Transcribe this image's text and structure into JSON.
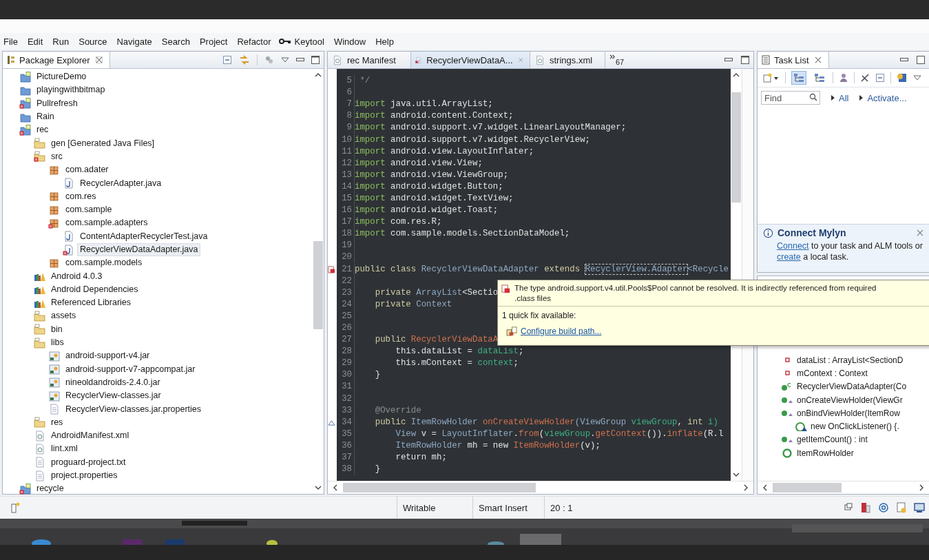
{
  "menu": [
    "File",
    "Edit",
    "Run",
    "Source",
    "Navigate",
    "Search",
    "Project",
    "Refactor",
    "Keytool",
    "Window",
    "Help"
  ],
  "package_explorer": {
    "title": "Package Explorer",
    "tree": [
      {
        "label": "PictureDemo",
        "kind": "android-project",
        "error": false,
        "selected": false
      },
      {
        "label": "playingwithbitmap",
        "kind": "project",
        "error": false,
        "selected": false
      },
      {
        "label": "Pullrefresh",
        "kind": "android-project",
        "error": true,
        "selected": false
      },
      {
        "label": "Rain",
        "kind": "project",
        "error": false,
        "selected": false
      },
      {
        "label": "rec",
        "kind": "android-project",
        "error": true,
        "selected": false,
        "children": [
          {
            "label": "gen [Generated Java Files]",
            "kind": "folder",
            "error": false,
            "selected": false
          },
          {
            "label": "src",
            "kind": "folder",
            "error": true,
            "selected": false,
            "children": [
              {
                "label": "com.adater",
                "kind": "package",
                "error": false,
                "selected": false,
                "children": [
                  {
                    "label": "RecyclerAdapter.java",
                    "kind": "java",
                    "error": false,
                    "selected": false
                  }
                ]
              },
              {
                "label": "com.res",
                "kind": "package",
                "error": false,
                "selected": false
              },
              {
                "label": "com.sample",
                "kind": "package",
                "error": false,
                "selected": false
              },
              {
                "label": "com.sample.adapters",
                "kind": "package",
                "error": true,
                "selected": false,
                "children": [
                  {
                    "label": "ContentAdapterRecyclerTest.java",
                    "kind": "java",
                    "error": false,
                    "selected": false
                  },
                  {
                    "label": "RecyclerViewDataAdapter.java",
                    "kind": "java",
                    "error": true,
                    "selected": true
                  }
                ]
              },
              {
                "label": "com.sample.models",
                "kind": "package",
                "error": false,
                "selected": false
              }
            ]
          },
          {
            "label": "Android 4.0.3",
            "kind": "library",
            "error": false,
            "selected": false
          },
          {
            "label": "Android Dependencies",
            "kind": "library",
            "error": false,
            "selected": false
          },
          {
            "label": "Referenced Libraries",
            "kind": "library",
            "error": false,
            "selected": false
          },
          {
            "label": "assets",
            "kind": "folder",
            "error": false,
            "selected": false
          },
          {
            "label": "bin",
            "kind": "folder",
            "error": false,
            "selected": false
          },
          {
            "label": "libs",
            "kind": "folder",
            "error": false,
            "selected": false,
            "children": [
              {
                "label": "android-support-v4.jar",
                "kind": "jar",
                "error": false,
                "selected": false
              },
              {
                "label": "android-support-v7-appcompat.jar",
                "kind": "jar",
                "error": false,
                "selected": false
              },
              {
                "label": "nineoldandroids-2.4.0.jar",
                "kind": "jar",
                "error": false,
                "selected": false
              },
              {
                "label": "RecyclerView-classes.jar",
                "kind": "jar",
                "error": false,
                "selected": false
              },
              {
                "label": "RecyclerView-classes.jar.properties",
                "kind": "file",
                "error": false,
                "selected": false
              }
            ]
          },
          {
            "label": "res",
            "kind": "folder",
            "error": false,
            "selected": false
          },
          {
            "label": "AndroidManifest.xml",
            "kind": "xml",
            "error": false,
            "selected": false
          },
          {
            "label": "lint.xml",
            "kind": "xml",
            "error": false,
            "selected": false
          },
          {
            "label": "proguard-project.txt",
            "kind": "file",
            "error": false,
            "selected": false
          },
          {
            "label": "project.properties",
            "kind": "file",
            "error": false,
            "selected": false
          }
        ]
      },
      {
        "label": "recycle",
        "kind": "android-project",
        "error": true,
        "selected": false
      }
    ]
  },
  "editor": {
    "tabs": [
      {
        "label": "rec Manifest",
        "kind": "xml",
        "selected": false
      },
      {
        "label": "RecyclerViewDataA...",
        "kind": "java",
        "selected": true
      },
      {
        "label": "strings.xml",
        "kind": "xml",
        "selected": false
      }
    ],
    "more_tabs": "67",
    "lines": [
      {
        "num": "5",
        "tokens": [
          {
            "text": " */",
            "kind": "comment"
          }
        ]
      },
      {
        "num": "6"
      },
      {
        "num": "7",
        "tokens": [
          {
            "text": "import",
            "kind": "keyword"
          },
          {
            "text": " java.util.ArrayList;",
            "kind": "plain"
          }
        ]
      },
      {
        "num": "8",
        "tokens": [
          {
            "text": "import",
            "kind": "keyword"
          },
          {
            "text": " android.content.Context;",
            "kind": "plain"
          }
        ]
      },
      {
        "num": "9",
        "tokens": [
          {
            "text": "import",
            "kind": "keyword"
          },
          {
            "text": " android.support.v7.widget.LinearLayoutManager;",
            "kind": "plain"
          }
        ]
      },
      {
        "num": "10",
        "tokens": [
          {
            "text": "import",
            "kind": "keyword"
          },
          {
            "text": " android.support.v7.widget.RecyclerView;",
            "kind": "plain"
          }
        ]
      },
      {
        "num": "11",
        "tokens": [
          {
            "text": "import",
            "kind": "keyword"
          },
          {
            "text": " android.view.LayoutInflater;",
            "kind": "plain"
          }
        ]
      },
      {
        "num": "12",
        "tokens": [
          {
            "text": "import",
            "kind": "keyword"
          },
          {
            "text": " android.view.View;",
            "kind": "plain"
          }
        ]
      },
      {
        "num": "13",
        "tokens": [
          {
            "text": "import",
            "kind": "keyword"
          },
          {
            "text": " android.view.ViewGroup;",
            "kind": "plain"
          }
        ]
      },
      {
        "num": "14",
        "tokens": [
          {
            "text": "import",
            "kind": "keyword"
          },
          {
            "text": " android.widget.Button;",
            "kind": "plain"
          }
        ]
      },
      {
        "num": "15",
        "tokens": [
          {
            "text": "import",
            "kind": "keyword"
          },
          {
            "text": " android.widget.TextView;",
            "kind": "plain"
          }
        ]
      },
      {
        "num": "16",
        "tokens": [
          {
            "text": "import",
            "kind": "keyword"
          },
          {
            "text": " android.widget.Toast;",
            "kind": "plain"
          }
        ]
      },
      {
        "num": "17",
        "tokens": [
          {
            "text": "import",
            "kind": "keyword"
          },
          {
            "text": " com.res.R;",
            "kind": "plain"
          }
        ]
      },
      {
        "num": "18",
        "tokens": [
          {
            "text": "import",
            "kind": "keyword"
          },
          {
            "text": " com.sample.models.SectionDataModel;",
            "kind": "plain"
          }
        ]
      },
      {
        "num": "19"
      },
      {
        "num": "20"
      },
      {
        "num": "21",
        "kind": "error",
        "tokens": [
          {
            "text": "public class",
            "kind": "modifier"
          },
          {
            "text": " RecyclerViewDataAdapter ",
            "kind": "type"
          },
          {
            "text": "extends ",
            "kind": "modifier"
          },
          {
            "text": "RecyclerView.Adapter",
            "kind": "type",
            "boxed": true
          },
          {
            "text": "<Recycle",
            "kind": "type"
          }
        ]
      },
      {
        "num": "22"
      },
      {
        "num": "23",
        "tokens": [
          {
            "text": "    private ",
            "kind": "modifier"
          },
          {
            "text": "ArrayList",
            "kind": "type"
          },
          {
            "text": "<Sectio",
            "kind": "plain"
          }
        ]
      },
      {
        "num": "24",
        "tokens": [
          {
            "text": "    private ",
            "kind": "modifier"
          },
          {
            "text": "Context",
            "kind": "type"
          }
        ]
      },
      {
        "num": "25"
      },
      {
        "num": "26"
      },
      {
        "num": "27",
        "tokens": [
          {
            "text": "    public ",
            "kind": "modifier"
          },
          {
            "text": "RecyclerViewDataA",
            "kind": "method"
          }
        ]
      },
      {
        "num": "28",
        "tokens": [
          {
            "text": "        this.dataList = ",
            "kind": "plain"
          },
          {
            "text": "dataList",
            "kind": "param"
          },
          {
            "text": ";",
            "kind": "plain"
          }
        ]
      },
      {
        "num": "29",
        "tokens": [
          {
            "text": "        this.mContext = ",
            "kind": "plain"
          },
          {
            "text": "context",
            "kind": "param"
          },
          {
            "text": ";",
            "kind": "plain"
          }
        ]
      },
      {
        "num": "30",
        "tokens": [
          {
            "text": "    }",
            "kind": "plain"
          }
        ]
      },
      {
        "num": "31"
      },
      {
        "num": "32"
      },
      {
        "num": "33",
        "tokens": [
          {
            "text": "    @Override",
            "kind": "annotation"
          }
        ]
      },
      {
        "num": "34",
        "kind": "override",
        "tokens": [
          {
            "text": "    public ",
            "kind": "modifier"
          },
          {
            "text": "ItemRowHolder ",
            "kind": "type"
          },
          {
            "text": "onCreateViewHolder",
            "kind": "method"
          },
          {
            "text": "(ViewGroup ",
            "kind": "type"
          },
          {
            "text": "viewGroup",
            "kind": "param"
          },
          {
            "text": ", ",
            "kind": "plain"
          },
          {
            "text": "int ",
            "kind": "modifier"
          },
          {
            "text": "i)",
            "kind": "param"
          }
        ]
      },
      {
        "num": "35",
        "tokens": [
          {
            "text": "        View ",
            "kind": "type"
          },
          {
            "text": "v = ",
            "kind": "plain"
          },
          {
            "text": "LayoutInflater",
            "kind": "type"
          },
          {
            "text": ".",
            "kind": "plain"
          },
          {
            "text": "from",
            "kind": "method"
          },
          {
            "text": "(",
            "kind": "plain"
          },
          {
            "text": "viewGroup",
            "kind": "param"
          },
          {
            "text": ".",
            "kind": "plain"
          },
          {
            "text": "getContext",
            "kind": "method"
          },
          {
            "text": "()).",
            "kind": "plain"
          },
          {
            "text": "inflate",
            "kind": "method"
          },
          {
            "text": "(R.l",
            "kind": "plain"
          }
        ]
      },
      {
        "num": "36",
        "tokens": [
          {
            "text": "        ItemRowHolder ",
            "kind": "type"
          },
          {
            "text": "mh = new ",
            "kind": "plain"
          },
          {
            "text": "ItemRowHolder",
            "kind": "method"
          },
          {
            "text": "(v);",
            "kind": "plain"
          }
        ]
      },
      {
        "num": "37",
        "tokens": [
          {
            "text": "        return mh;",
            "kind": "plain"
          }
        ]
      },
      {
        "num": "38",
        "tokens": [
          {
            "text": "    }",
            "kind": "plain"
          }
        ]
      }
    ]
  },
  "task_list": {
    "title": "Task List",
    "toggles": [
      {
        "pressed": true
      },
      {
        "pressed": false
      }
    ],
    "find": {
      "placeholder": "Find"
    },
    "links": [
      "All",
      "Activate..."
    ],
    "mylyn": {
      "title": "Connect Mylyn",
      "parts": [
        {
          "text": "Connect",
          "kind": "link"
        },
        {
          "text": " to your task and ALM tools or ",
          "kind": "text"
        },
        {
          "text": "create",
          "kind": "link"
        },
        {
          "text": " a local task.",
          "kind": "text"
        }
      ]
    }
  },
  "outline": {
    "items": [
      {
        "text": "dataList : ArrayList<SectionD",
        "kind": "field"
      },
      {
        "text": "mContext : Context",
        "kind": "field"
      },
      {
        "text": "RecyclerViewDataAdapter(Co",
        "kind": "constructor"
      },
      {
        "text": "onCreateViewHolder(ViewGr",
        "kind": "method"
      },
      {
        "text": "onBindViewHolder(ItemRow",
        "kind": "method",
        "children": [
          {
            "text": "new OnClickListener() {.",
            "kind": "anonymous"
          }
        ]
      },
      {
        "text": "getItemCount() : int",
        "kind": "method"
      },
      {
        "text": "ItemRowHolder",
        "kind": "class"
      }
    ]
  },
  "popup": {
    "message_lines": [
      "The type android.support.v4.util.Pools$Pool cannot be resolved. It is indirectly referenced from required",
      ".class files"
    ],
    "quick_fix_count": "1 quick fix available:",
    "fix": "Configure build path..."
  },
  "status_bar": [
    "Writable",
    "Smart Insert",
    "20 : 1"
  ]
}
